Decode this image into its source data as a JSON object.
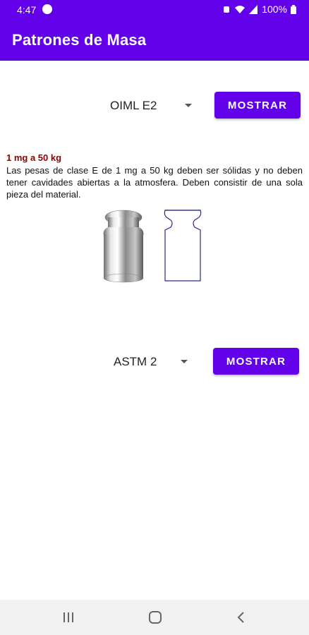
{
  "status_bar": {
    "time": "4:47",
    "battery": "100%"
  },
  "app_bar": {
    "title": "Patrones de Masa"
  },
  "section_1": {
    "selected_option": "OIML E2",
    "button_label": "MOSTRAR",
    "range_title": "1 mg a 50 kg",
    "description": "Las pesas de clase E de 1 mg a 50 kg deben ser sólidas y no deben tener cavidades abiertas a la atmosfera. Deben consistir de una sola pieza del material."
  },
  "section_2": {
    "selected_option": "ASTM 2",
    "button_label": "MOSTRAR"
  },
  "colors": {
    "primary": "#6200ea",
    "range_title": "#8b0000",
    "outline": "#2b2b8a"
  },
  "icons": {
    "nav_recents": "recents-icon",
    "nav_home": "home-icon",
    "nav_back": "back-icon"
  }
}
